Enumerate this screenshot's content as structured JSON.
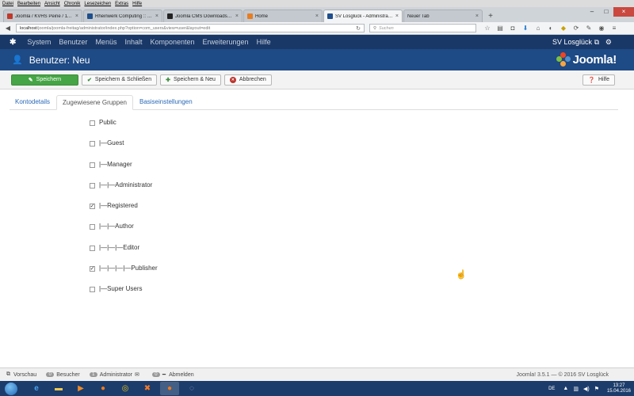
{
  "browser": {
    "menu": [
      "Datei",
      "Bearbeiten",
      "Ansicht",
      "Chronik",
      "Lesezeichen",
      "Extras",
      "Hilfe"
    ],
    "tabs": [
      {
        "label": "Joomla / KVHS Peine / 11. ...",
        "color": "#c0392b"
      },
      {
        "label": "Rheinwerk Computing :: Jo...",
        "color": "#1f4e8c"
      },
      {
        "label": "Joomla CMS Downloads - ...",
        "color": "#222222"
      },
      {
        "label": "Home",
        "color": "#e67e22"
      },
      {
        "label": "SV Losglück - Administrati...",
        "color": "#1f4e8c"
      },
      {
        "label": "Neuer Tab",
        "color": "#cccccc"
      }
    ],
    "url_host": "localhost",
    "url_path": "/joomla/joomla-freitag/administrator/index.php?option=com_users&view=user&layout=edit",
    "search_placeholder": "Suchen"
  },
  "joomla_nav": {
    "items": [
      "System",
      "Benutzer",
      "Menüs",
      "Inhalt",
      "Komponenten",
      "Erweiterungen",
      "Hilfe"
    ],
    "site_name": "SV Losglück"
  },
  "header": {
    "title": "Benutzer: Neu",
    "brand": "Joomla!"
  },
  "toolbar": {
    "save": "Speichern",
    "save_close": "Speichern & Schließen",
    "save_new": "Speichern & Neu",
    "cancel": "Abbrechen",
    "help": "Hilfe"
  },
  "tabs": {
    "account": "Kontodetails",
    "groups": "Zugewiesene Gruppen",
    "basic": "Basiseinstellungen"
  },
  "groups": [
    {
      "label": "Public",
      "checked": false
    },
    {
      "label": "|—Guest",
      "checked": false
    },
    {
      "label": "|—Manager",
      "checked": false
    },
    {
      "label": "|—|—Administrator",
      "checked": false
    },
    {
      "label": "|—Registered",
      "checked": true
    },
    {
      "label": "|—|—Author",
      "checked": false
    },
    {
      "label": "|—|—|—Editor",
      "checked": false
    },
    {
      "label": "|—|—|—|—Publisher",
      "checked": true
    },
    {
      "label": "|—Super Users",
      "checked": false
    }
  ],
  "statusbar": {
    "preview": "Vorschau",
    "visitors_count": "0",
    "visitors": "Besucher",
    "admins_count": "1",
    "admins": "Administrator",
    "logout_count": "0",
    "logout": "Abmelden",
    "version": "Joomla! 3.5.1 — © 2016 SV Losglück"
  },
  "taskbar": {
    "lang": "DE",
    "time": "13:27",
    "date": "15.04.2016"
  }
}
